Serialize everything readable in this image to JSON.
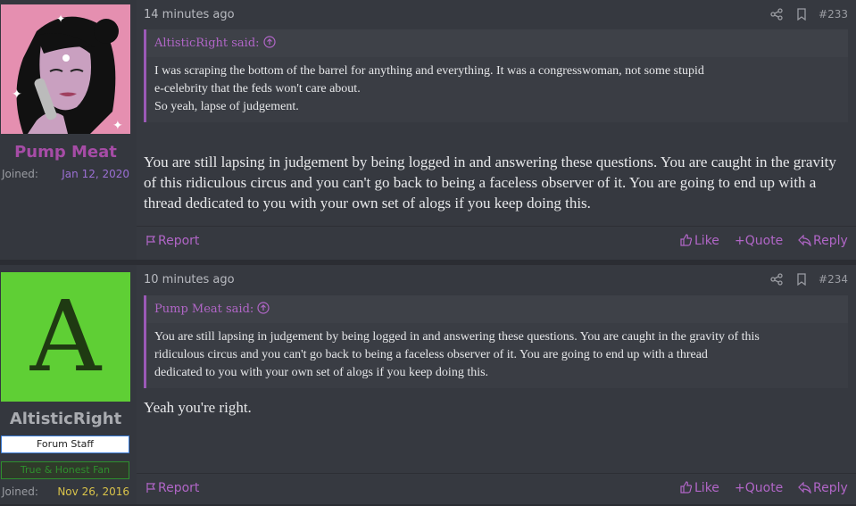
{
  "posts": [
    {
      "username": "Pump Meat",
      "joined_label": "Joined:",
      "joined_date": "Jan 12, 2020",
      "time": "14 minutes ago",
      "number": "#233",
      "quote_author": "AltisticRight said:",
      "quote_lines": [
        "I was scraping the bottom of the barrel for anything and everything. It was a congresswoman, not some stupid",
        "e-celebrity that the feds won't care about.",
        "So yeah, lapse of judgement."
      ],
      "text": "You are still lapsing in judgement by being logged in and answering these questions. You are caught in the gravity of this ridiculous circus and you can't go back to being a faceless observer of it. You are going to end up with a thread dedicated to you with your own set of alogs if you keep doing this.",
      "actions": {
        "report": "Report",
        "like": "Like",
        "quote": "Quote",
        "reply": "Reply"
      },
      "colors": {
        "username": "#a64ca6",
        "joined_date": "#9b6fd4"
      }
    },
    {
      "username": "AltisticRight",
      "avatar_letter": "A",
      "badge1": "Forum Staff",
      "badge2": "True & Honest Fan",
      "joined_label": "Joined:",
      "joined_date": "Nov 26, 2016",
      "time": "10 minutes ago",
      "number": "#234",
      "quote_author": "Pump Meat said:",
      "quote_lines": [
        "You are still lapsing in judgement by being logged in and answering these questions. You are caught in the gravity of this",
        "ridiculous circus and you can't go back to being a faceless observer of it. You are going to end up with a thread",
        "dedicated to you with your own set of alogs if you keep doing this."
      ],
      "text": "Yeah you're right.",
      "actions": {
        "report": "Report",
        "like": "Like",
        "quote": "Quote",
        "reply": "Reply"
      },
      "colors": {
        "username": "#a9abb0",
        "joined_date": "#d9c34a",
        "avatar_bg": "#5fcf35"
      }
    }
  ]
}
